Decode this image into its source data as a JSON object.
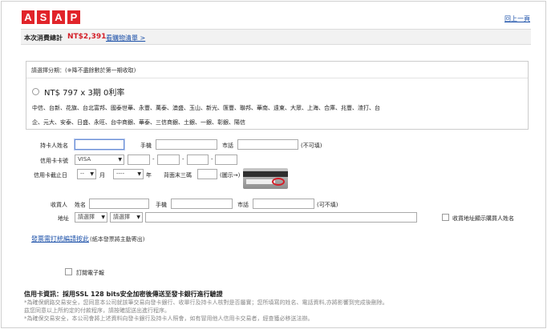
{
  "logo": [
    "A",
    "S",
    "A",
    "P"
  ],
  "header": {
    "back_label": "回上一頁"
  },
  "summary": {
    "label": "本次消費總計",
    "amount": "NT$2,391",
    "cart_link": "看購物清單 >"
  },
  "installment": {
    "hint": "請選擇分期：(※降不盡餘數於第一期收取)",
    "option_label": "NT$ 797 x  3期 0利率",
    "banks_line1": "中信、台新、花旗、台北富邦、國泰世華、永豐、萬泰、澳盛、玉山、新光、匯豐、聯邦、華南、遠東、大眾、上海、合庫、兆豐、渣打、台",
    "banks_line2": "企、元大、安泰、日盛、永旺、台中商銀、華泰、三信商銀、土銀、一銀、彰銀、陽信"
  },
  "card_form": {
    "holder_name_label": "持卡人姓名",
    "mobile_label": "手機",
    "phone_label": "市話",
    "optional": "(不可填)",
    "card_no_label": "信用卡卡號",
    "card_type": "VISA",
    "expiry_label": "信用卡截止日",
    "month_value": "--",
    "month_unit": "月",
    "year_value": "----",
    "year_unit": "年",
    "cvv_label": "背面末三碼",
    "cvv_hint": "(圖示→)"
  },
  "recipient": {
    "label": "收貨人",
    "name_label": "姓名",
    "mobile_label": "手機",
    "phone_label": "市話",
    "optional": "(可不填)",
    "address_label": "地址",
    "city_placeholder": "請選擇",
    "district_placeholder": "請選擇",
    "same_holder_label": "收貨地址顯示購買人姓名"
  },
  "invoice": {
    "link": "發票需打統編請按此",
    "note": "(紙本發票將主動寄出)",
    "subscribe_label": "訂閱電子報"
  },
  "notes": {
    "title": "信用卡資訊：採用SSL 128 bits安全加密後傳送至發卡銀行進行驗證",
    "line1": "*為確保網路交易安全，您同意本公司就該筆交易向發卡銀行、收單行及持卡人核對是否屬實；您所填寫的姓名、電話資料,亦將影響到完成後刪除。",
    "line2": "茲您同意以上所約定的付款程序，請按確認送出進行程序。",
    "line3": "*為確保交易安全，本公司會將上述資料向發卡銀行及持卡人照會，如有冒用他人信用卡交易者，經查獲必移送法辦。"
  },
  "colors": {
    "brand_red": "#e1242a",
    "link_blue": "#1a4fa8",
    "amount_red": "#d4202a"
  }
}
